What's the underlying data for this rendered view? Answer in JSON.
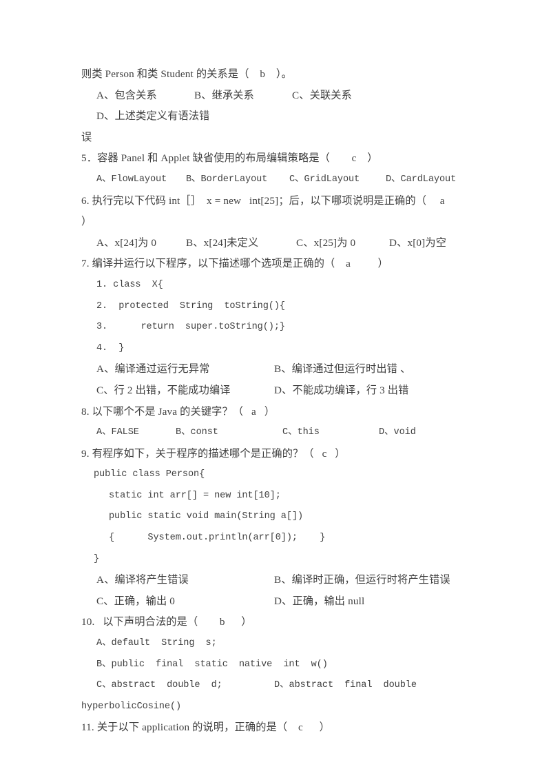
{
  "document": {
    "type": "exam-paper",
    "language": "zh-CN",
    "subject_hint": "Java",
    "background_color": "#ffffff",
    "text_color": "#3f3f3f"
  },
  "questions": [
    {
      "id": "q4-continuation",
      "stem": "则类 Person 和类 Student 的关系是（    b    ）。",
      "options_row": {
        "a": "A、包含关系",
        "b": "B、继承关系",
        "c": "C、关联关系",
        "d": "D、上述类定义有语法错"
      },
      "wrapped_tail": "误"
    },
    {
      "id": "q5",
      "stem": "5．容器 Panel 和 Applet 缺省使用的布局编辑策略是（        c    ）",
      "options_row": {
        "a": "A、FlowLayout",
        "b": "B、BorderLayout",
        "c": "C、GridLayout",
        "d": "D、CardLayout"
      }
    },
    {
      "id": "q6",
      "stem": "6. 执行完以下代码 int［］  x = new   int[25]；后，以下哪项说明是正确的（     a",
      "wrapped_tail": "）",
      "options_row": {
        "a": "A、x[24]为 0",
        "b": "B、x[24]未定义",
        "c": "C、x[25]为 0",
        "d": "D、x[0]为空"
      }
    },
    {
      "id": "q7",
      "stem": "7. 编译并运行以下程序，以下描述哪个选项是正确的（    a          ）",
      "code": [
        "1. class  X{",
        "2.  protected  String  toString(){",
        "3.      return  super.toString();}",
        "4.  }"
      ],
      "options_grid": [
        {
          "left": "A、编译通过运行无异常",
          "right": "B、编译通过但运行时出错 、"
        },
        {
          "left": "C、行 2 出错，不能成功编译",
          "right": "D、不能成功编译，行 3 出错"
        }
      ]
    },
    {
      "id": "q8",
      "stem": "8. 以下哪个不是 Java 的关键字？（   a   ）",
      "options_row": {
        "a": "A、FALSE",
        "b": "B、const",
        "c": "C、this",
        "d": "D、void"
      }
    },
    {
      "id": "q9",
      "stem": "9. 有程序如下，关于程序的描述哪个是正确的？（   c   ）",
      "code": [
        "public class Person{",
        "static int arr[] = new int[10];",
        "public static void main(String a[])",
        "{      System.out.println(arr[0]);    }",
        "}"
      ],
      "options_grid": [
        {
          "left": "A、编译将产生错误",
          "right": "B、编译时正确，但运行时将产生错误"
        },
        {
          "left": "C、正确，输出 0",
          "right": "D、正确，输出 null"
        }
      ]
    },
    {
      "id": "q10",
      "stem": "10.   以下声明合法的是（        b      ）",
      "options_grid": [
        {
          "left": "A、default  String  s;",
          "right": "B、public  final  static  native  int  w()"
        },
        {
          "left": "C、abstract  double  d;",
          "right": "D、abstract  final  double"
        }
      ],
      "wrapped_tail": "hyperbolicCosine()"
    },
    {
      "id": "q11",
      "stem": "11. 关于以下 application 的说明，正确的是（    c      ）"
    }
  ]
}
